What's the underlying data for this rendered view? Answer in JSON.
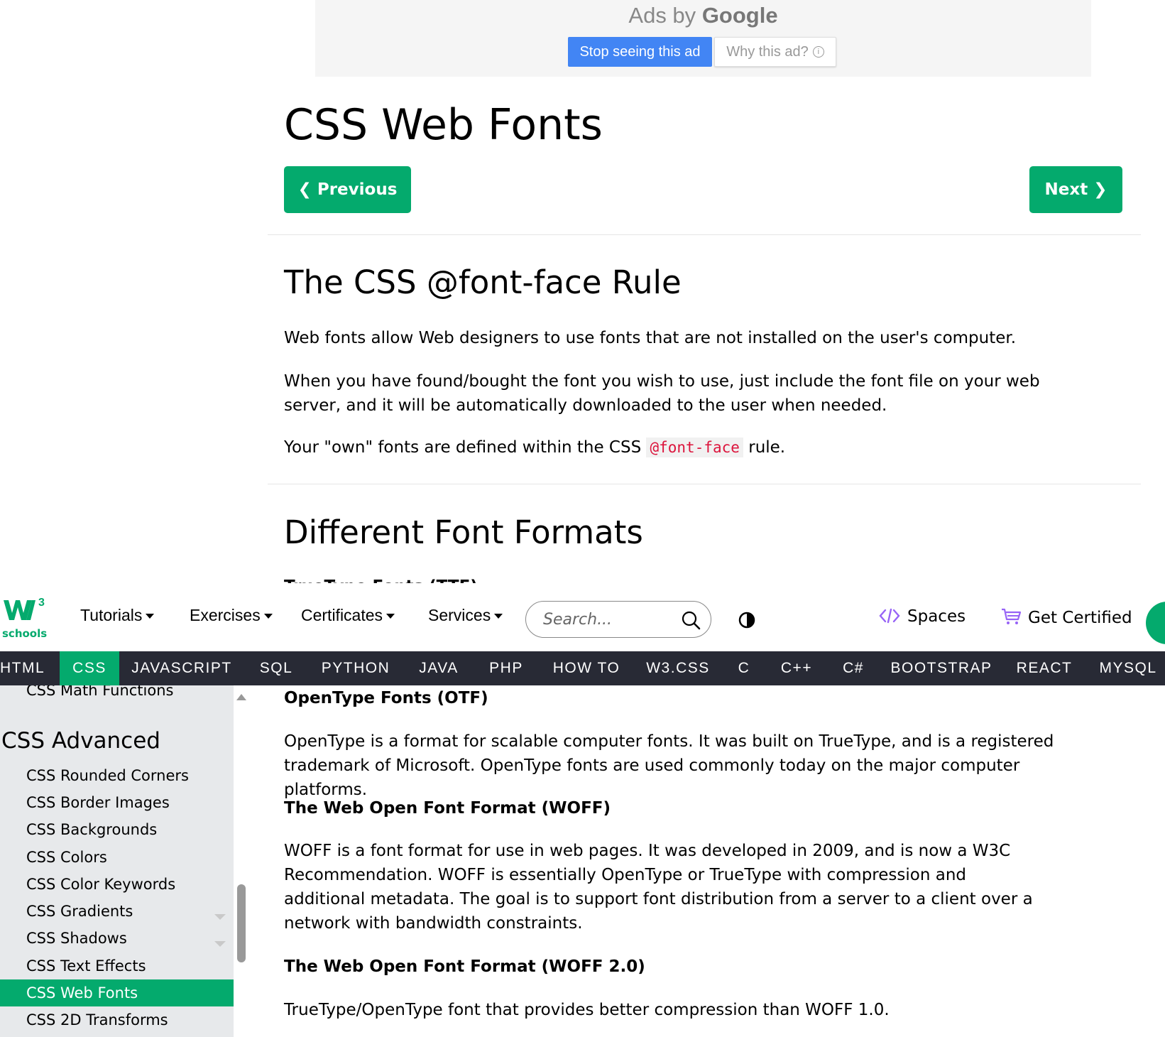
{
  "ad": {
    "ads_by": "Ads by",
    "google": "Google",
    "stop_label": "Stop seeing this ad",
    "why_label": "Why this ad?",
    "info_glyph": "i"
  },
  "content": {
    "title": "CSS Web Fonts",
    "prev_label": "❮ Previous",
    "next_label": "Next ❯",
    "h2_fontface": "The CSS @font-face Rule",
    "p1": "Web fonts allow Web designers to use fonts that are not installed on the user's computer.",
    "p2": "When you have found/bought the font you wish to use, just include the font file on your web server, and it will be automatically downloaded to the user when needed.",
    "p3_before": "Your \"own\" fonts are defined within the CSS",
    "p3_code": "@font-face",
    "p3_after": "rule.",
    "h2_formats": "Different Font Formats",
    "h4_ttf": "TrueType Fonts (TTF)",
    "h4_otf": "OpenType Fonts (OTF)",
    "p_otf": "OpenType is a format for scalable computer fonts. It was built on TrueType, and is a registered trademark of Microsoft. OpenType fonts are used commonly today on the major computer platforms.",
    "h4_woff": "The Web Open Font Format (WOFF)",
    "p_woff": "WOFF is a font format for use in web pages. It was developed in 2009, and is now a W3C Recommendation. WOFF is essentially OpenType or TrueType with compression and additional metadata. The goal is to support font distribution from a server to a client over a network with bandwidth constraints.",
    "h4_woff2": "The Web Open Font Format (WOFF 2.0)",
    "p_woff2": "TrueType/OpenType font that provides better compression than WOFF 1.0."
  },
  "topnav": {
    "logo_text": "schools",
    "logo_sup": "3",
    "menus": [
      "Tutorials",
      "Exercises",
      "Certificates",
      "Services"
    ],
    "search_placeholder": "Search...",
    "spaces_label": "Spaces",
    "certified_label": "Get Certified",
    "brand_color": "#04aa6d"
  },
  "langbar": {
    "items": [
      "HTML",
      "CSS",
      "JAVASCRIPT",
      "SQL",
      "PYTHON",
      "JAVA",
      "PHP",
      "HOW TO",
      "W3.CSS",
      "C",
      "C++",
      "C#",
      "BOOTSTRAP",
      "REACT",
      "MYSQL"
    ],
    "active": "CSS"
  },
  "sidebar": {
    "top_partial": "CSS Math Functions",
    "section": "CSS Advanced",
    "items": [
      "CSS Rounded Corners",
      "CSS Border Images",
      "CSS Backgrounds",
      "CSS Colors",
      "CSS Color Keywords",
      "CSS Gradients",
      "CSS Shadows",
      "CSS Text Effects",
      "CSS Web Fonts",
      "CSS 2D Transforms"
    ],
    "active": "CSS Web Fonts"
  }
}
